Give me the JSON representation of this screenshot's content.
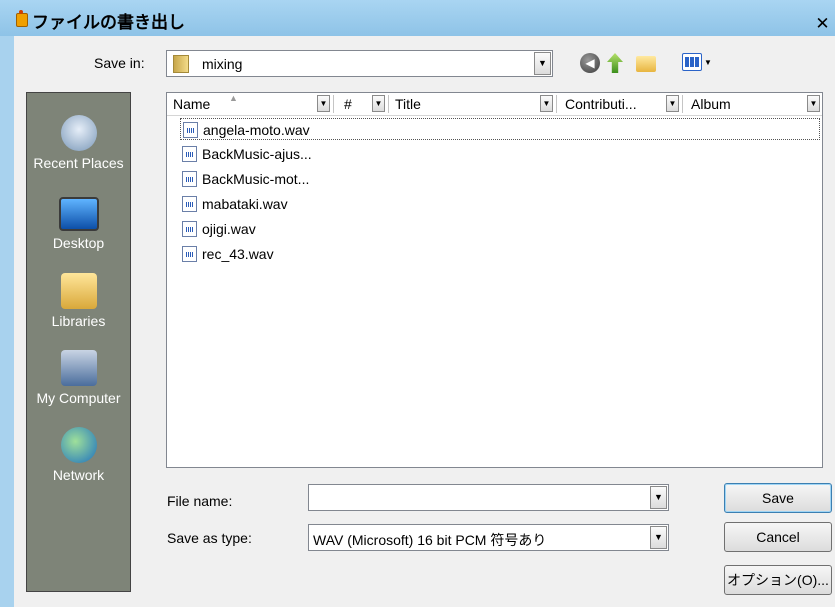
{
  "window": {
    "title": "ファイルの書き出し",
    "close": "✕"
  },
  "save_in": {
    "label": "Save in:",
    "value": "mixing"
  },
  "toolbar": {
    "icons": [
      "back-icon",
      "up-folder-icon",
      "new-folder-icon",
      "view-menu-icon"
    ]
  },
  "places": [
    {
      "label": "Recent Places",
      "icon": "recent-places-icon"
    },
    {
      "label": "Desktop",
      "icon": "desktop-icon"
    },
    {
      "label": "Libraries",
      "icon": "libraries-icon"
    },
    {
      "label": "My Computer",
      "icon": "computer-icon"
    },
    {
      "label": "Network",
      "icon": "network-icon"
    }
  ],
  "columns": {
    "name": "Name",
    "number": "#",
    "title": "Title",
    "contributing": "Contributi...",
    "album": "Album"
  },
  "files": [
    "angela-moto.wav",
    "BackMusic-ajus...",
    "BackMusic-mot...",
    "mabataki.wav",
    "ojigi.wav",
    "rec_43.wav"
  ],
  "filename": {
    "label": "File name:",
    "value": ""
  },
  "savetype": {
    "label": "Save as type:",
    "value": "WAV (Microsoft) 16 bit PCM 符号あり"
  },
  "buttons": {
    "save": "Save",
    "cancel": "Cancel",
    "options": "オプション(O)..."
  },
  "colors": {
    "title_bg": "#a9d5f2",
    "dialog_bg": "#f0f0f0",
    "places_bg": "#7e8478"
  }
}
